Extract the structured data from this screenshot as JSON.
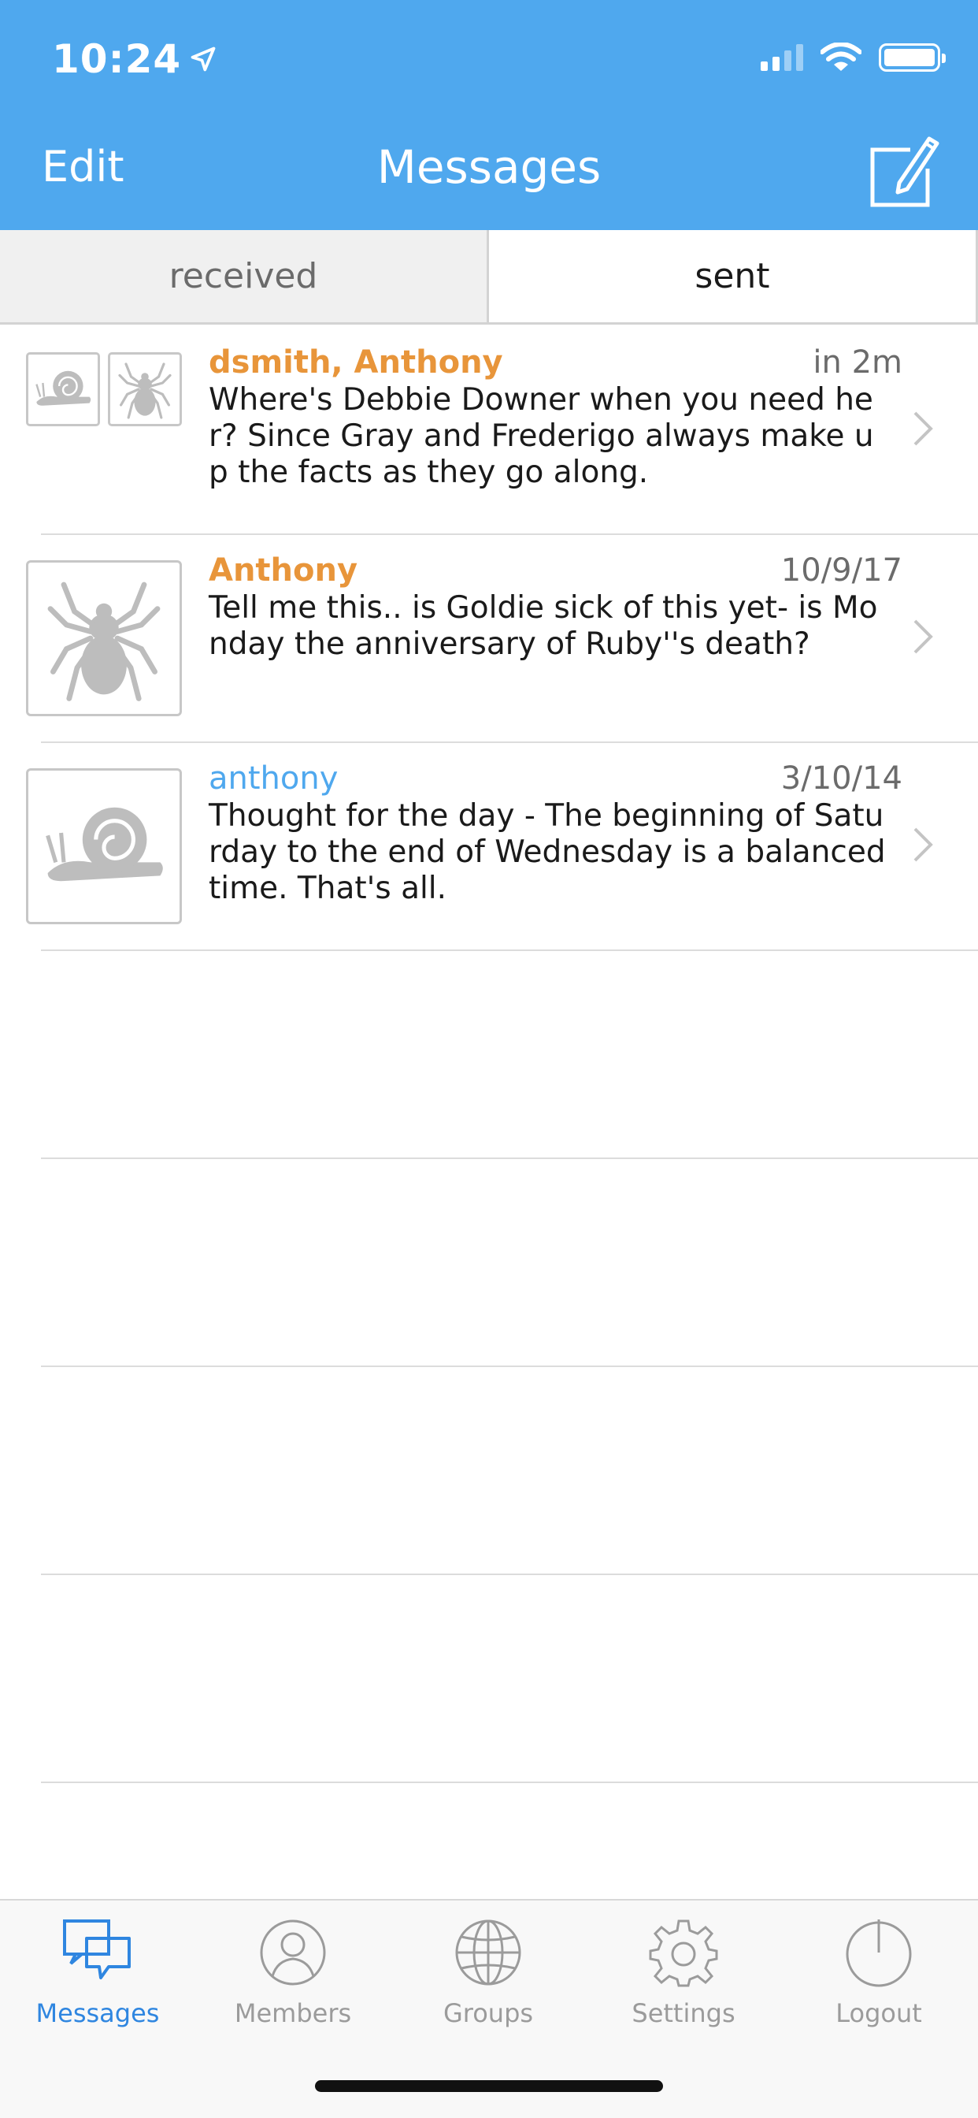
{
  "status_bar": {
    "time": "10:24"
  },
  "nav": {
    "edit_label": "Edit",
    "title": "Messages"
  },
  "segments": {
    "received": "received",
    "sent": "sent",
    "selected": "sent"
  },
  "messages": [
    {
      "sender": "dsmith, Anthony",
      "sender_color": "#e8953a",
      "date": "in 2m",
      "preview": "Where's Debbie Downer when you need her? Since Gray and Frederigo always make up the facts as they go along.",
      "avatars": [
        "snail-icon",
        "spider-icon"
      ]
    },
    {
      "sender": "Anthony",
      "sender_color": "#e8953a",
      "date": "10/9/17",
      "preview": "Tell me this.. is Goldie sick of this yet- is Monday the anniversary of Ruby''s death?",
      "avatars": [
        "spider-icon"
      ]
    },
    {
      "sender": "anthony",
      "sender_color": "#4fa8ee",
      "date": "3/10/14",
      "preview": "Thought for the day - The beginning of Saturday to the end of Wednesday is a balanced time. That's all.",
      "avatars": [
        "snail-icon"
      ]
    }
  ],
  "tabs": [
    {
      "label": "Messages",
      "icon": "chat-bubbles-icon",
      "active": true
    },
    {
      "label": "Members",
      "icon": "person-icon",
      "active": false
    },
    {
      "label": "Groups",
      "icon": "globe-icon",
      "active": false
    },
    {
      "label": "Settings",
      "icon": "gear-icon",
      "active": false
    },
    {
      "label": "Logout",
      "icon": "power-icon",
      "active": false
    }
  ],
  "colors": {
    "header": "#4fa8ee",
    "accent": "#2f86e0",
    "orange": "#e8953a"
  }
}
